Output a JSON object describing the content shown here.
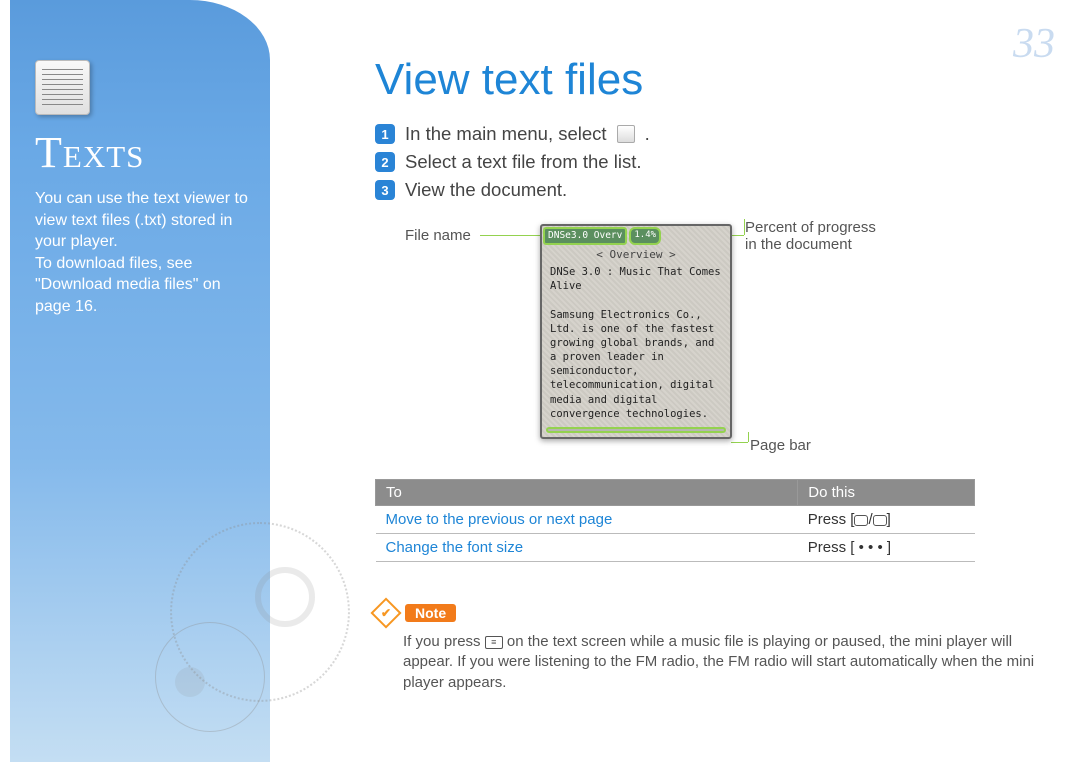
{
  "page_number": "33",
  "sidebar": {
    "title": "Texts",
    "body_1": "You can use the text viewer to view text files (.txt) stored in your player.",
    "body_2": "To download files, see \"Download media files\" on page 16."
  },
  "main": {
    "title": "View text files",
    "steps": [
      "In the main menu, select",
      "Select a text file from the list.",
      "View the document."
    ],
    "step1_suffix": "."
  },
  "device": {
    "file_name_label": "File name",
    "file_name_value": "DNSe3.0 Overv",
    "percent_label_l1": "Percent of progress",
    "percent_label_l2": "in the document",
    "percent_value": "1.4%",
    "subtitle": "< Overview >",
    "body_l1": "DNSe 3.0 : Music That Comes Alive",
    "body_l2": "Samsung Electronics Co., Ltd. is one of the fastest growing global brands, and a proven leader in semiconductor, telecommunication, digital media and digital convergence technologies.",
    "pagebar_label": "Page bar"
  },
  "table": {
    "h1": "To",
    "h2": "Do this",
    "rows": [
      {
        "action": "Move to the previous or next page",
        "do_prefix": "Press [",
        "do_mid": "/",
        "do_suffix": "]"
      },
      {
        "action": "Change the font size",
        "do": "Press [ • • • ]"
      }
    ]
  },
  "note": {
    "badge": "Note",
    "text_1": "If you press ",
    "text_2": " on the text screen while a music file is playing or paused, the mini player will appear. If you were listening to the FM radio, the FM radio will start automatically when the mini player appears."
  }
}
